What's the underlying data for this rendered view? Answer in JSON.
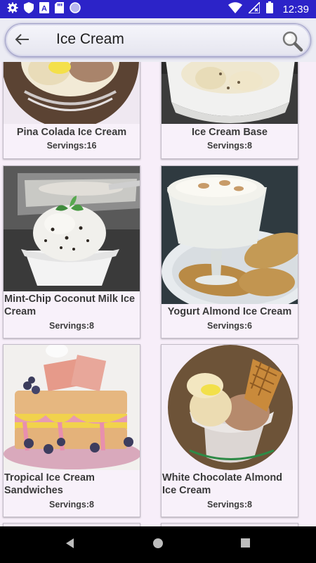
{
  "status_bar": {
    "time": "12:39",
    "left_icons": [
      "gear-icon",
      "shield-icon",
      "font-icon",
      "sd-card-icon",
      "circle-icon"
    ],
    "right_icons": [
      "wifi-icon",
      "no-sim-icon",
      "battery-icon"
    ]
  },
  "app_bar": {
    "search_value": "Ice Cream",
    "back_icon": "arrow-left-icon",
    "search_icon": "magnifier-icon"
  },
  "recipes": [
    {
      "title": "Pina Colada Ice Cream",
      "servings": "Servings:16"
    },
    {
      "title": "Ice Cream Base",
      "servings": "Servings:8"
    },
    {
      "title": "Mint-Chip Coconut Milk Ice Cream",
      "servings": "Servings:8"
    },
    {
      "title": "Yogurt Almond Ice Cream",
      "servings": "Servings:6"
    },
    {
      "title": "Tropical Ice Cream Sandwiches",
      "servings": "Servings:8"
    },
    {
      "title": "White Chocolate Almond Ice Cream",
      "servings": "Servings:8"
    }
  ],
  "nav_bar": {
    "icons": [
      "back-triangle-icon",
      "home-circle-icon",
      "recents-square-icon"
    ]
  }
}
